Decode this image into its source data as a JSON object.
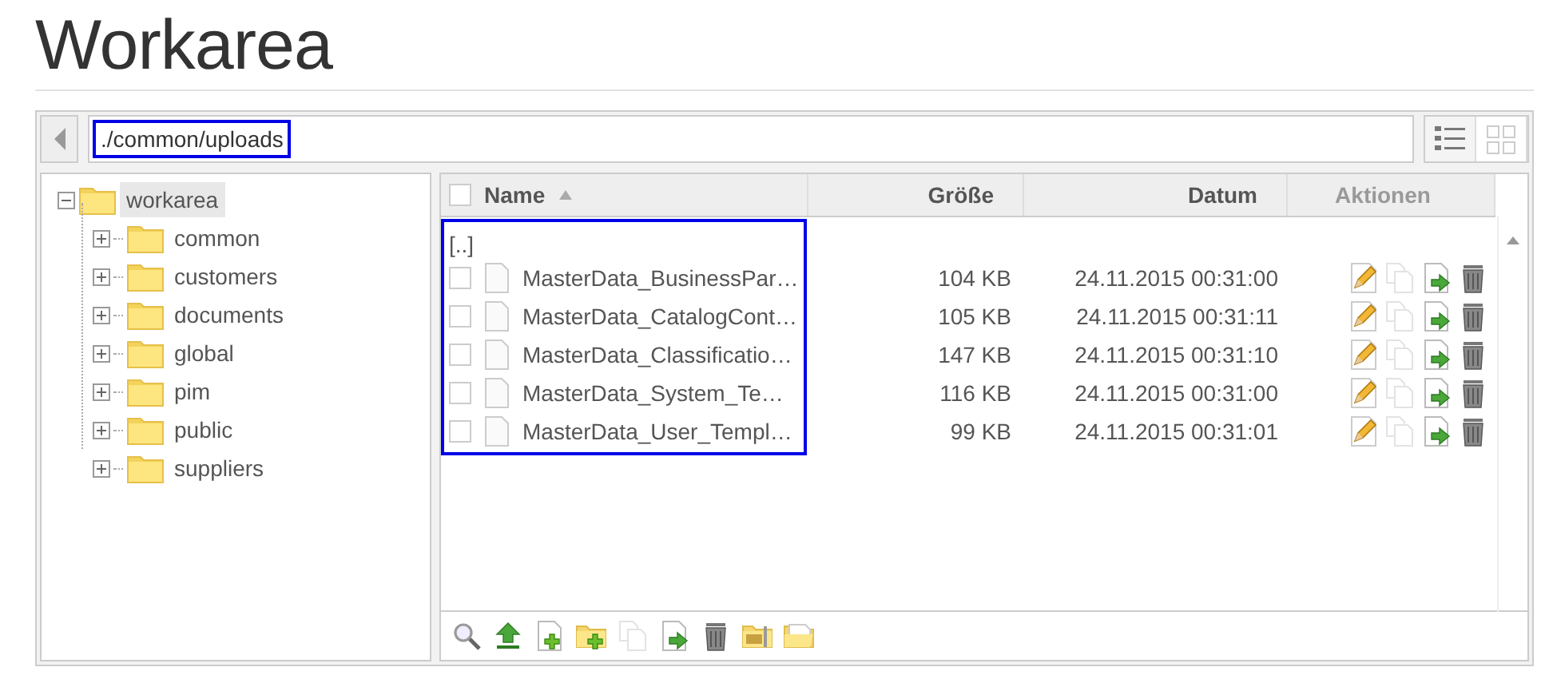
{
  "title": "Workarea",
  "path": {
    "value": "./common/uploads",
    "highlighted": true
  },
  "view_modes": [
    {
      "kind": "list",
      "selected": true
    },
    {
      "kind": "grid",
      "selected": false
    }
  ],
  "tree": {
    "label": "workarea",
    "expanded": true,
    "selected": true,
    "children": [
      {
        "label": "common",
        "expanded": false
      },
      {
        "label": "customers",
        "expanded": false
      },
      {
        "label": "documents",
        "expanded": false
      },
      {
        "label": "global",
        "expanded": false
      },
      {
        "label": "pim",
        "expanded": false
      },
      {
        "label": "public",
        "expanded": false
      },
      {
        "label": "suppliers",
        "expanded": false
      }
    ]
  },
  "select_all": {
    "checked": false
  },
  "columns": [
    {
      "label": "Name",
      "sort_ascending": true,
      "disabled": false
    },
    {
      "label": "Größe",
      "sort_ascending": false,
      "disabled": false
    },
    {
      "label": "Datum",
      "sort_ascending": false,
      "disabled": false
    },
    {
      "label": "Aktionen",
      "sort_ascending": false,
      "disabled": true
    }
  ],
  "parent_link": "[..]",
  "files_highlighted": true,
  "files": [
    {
      "name": "MasterData_BusinessPar…",
      "size": "104 KB",
      "date": "24.11.2015 00:31:00",
      "checked": false
    },
    {
      "name": "MasterData_CatalogCont…",
      "size": "105 KB",
      "date": "24.11.2015 00:31:11",
      "checked": false
    },
    {
      "name": "MasterData_Classificatio…",
      "size": "147 KB",
      "date": "24.11.2015 00:31:10",
      "checked": false
    },
    {
      "name": "MasterData_System_Te…",
      "size": "116 KB",
      "date": "24.11.2015 00:31:00",
      "checked": false
    },
    {
      "name": "MasterData_User_Templ…",
      "size": "99 KB",
      "date": "24.11.2015 00:31:01",
      "checked": false
    }
  ],
  "row_actions": [
    {
      "kind": "edit",
      "disabled": false
    },
    {
      "kind": "copy",
      "disabled": true
    },
    {
      "kind": "move",
      "disabled": false
    },
    {
      "kind": "delete",
      "disabled": false
    }
  ],
  "toolbar": [
    {
      "kind": "search",
      "disabled": false
    },
    {
      "kind": "upload",
      "disabled": false
    },
    {
      "kind": "newfile",
      "disabled": false
    },
    {
      "kind": "newfolder",
      "disabled": false
    },
    {
      "kind": "copy",
      "disabled": true
    },
    {
      "kind": "move",
      "disabled": false
    },
    {
      "kind": "delete",
      "disabled": false
    },
    {
      "kind": "zip",
      "disabled": false
    },
    {
      "kind": "unzip",
      "disabled": false
    }
  ]
}
